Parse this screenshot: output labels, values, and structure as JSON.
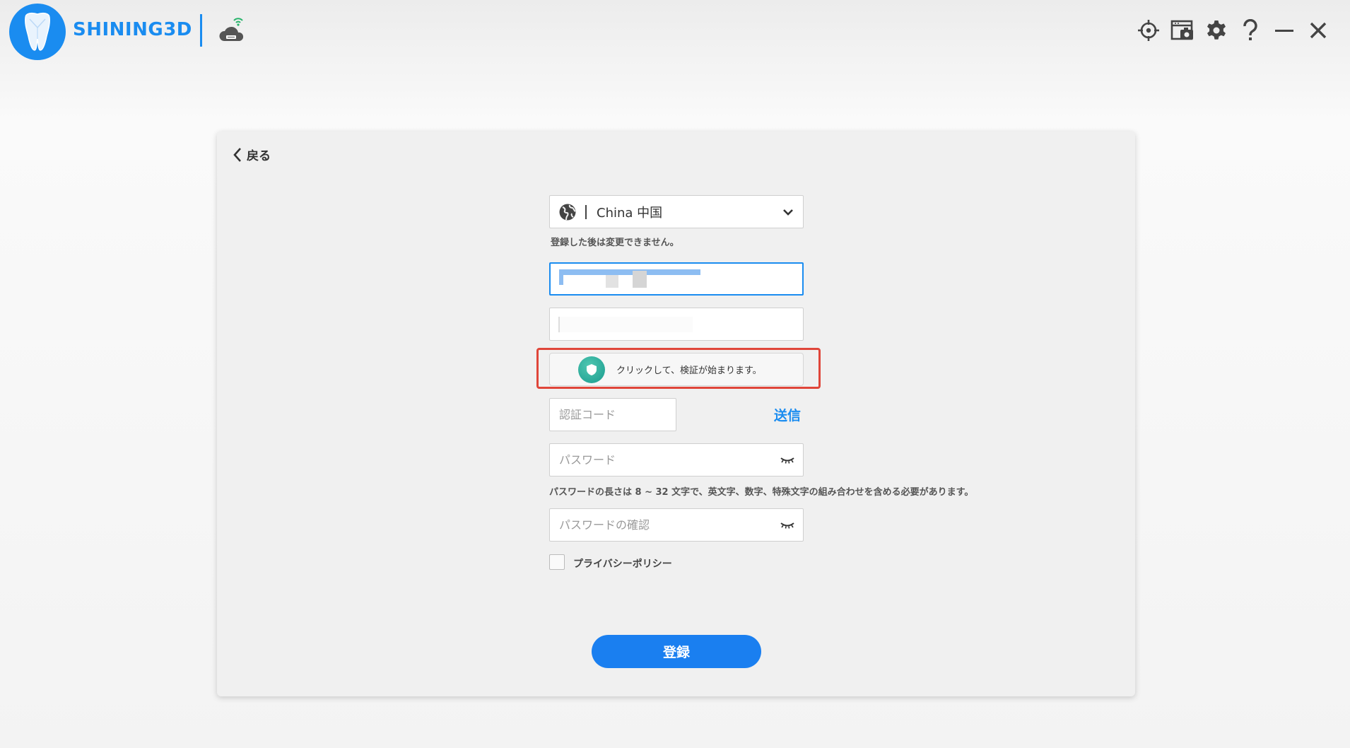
{
  "app": {
    "brand": "SHINING3D"
  },
  "window_controls": [
    {
      "name": "target-icon"
    },
    {
      "name": "screenshot-icon"
    },
    {
      "name": "gear-icon"
    },
    {
      "name": "help-icon"
    },
    {
      "name": "minimize-icon"
    },
    {
      "name": "close-icon"
    }
  ],
  "back": {
    "label": "戻る"
  },
  "country": {
    "selected": "China 中国",
    "hint": "登録した後は変更できません。"
  },
  "captcha": {
    "label": "クリックして、検証が始まります。"
  },
  "verification": {
    "placeholder": "認証コード",
    "send_label": "送信"
  },
  "password": {
    "placeholder": "パスワード",
    "hint": "パスワードの長さは 8 ~ 32 文字で、英文字、数字、特殊文字の組み合わせを含める必要があります。"
  },
  "confirm_password": {
    "placeholder": "パスワードの確認"
  },
  "privacy": {
    "label": "プライバシーポリシー",
    "checked": false
  },
  "submit": {
    "label": "登録"
  },
  "colors": {
    "accent": "#1a8cf0",
    "highlight_outline": "#e0463a",
    "captcha_shield": "#1a9b8e"
  }
}
